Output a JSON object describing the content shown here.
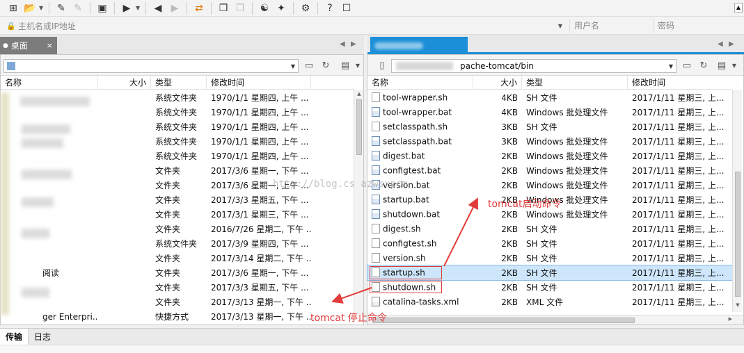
{
  "connection": {
    "host_placeholder": "主机名或IP地址",
    "user_placeholder": "用户名",
    "pass_placeholder": "密码"
  },
  "left_pane": {
    "tab_label": "桌面",
    "tab_close": "×",
    "columns": {
      "name": "名称",
      "size": "大小",
      "type": "类型",
      "mtime": "修改时间"
    },
    "rows": [
      {
        "name": "",
        "size": "",
        "type": "系统文件夹",
        "mtime": "1970/1/1 星期四, 上午 ..."
      },
      {
        "name": "",
        "size": "",
        "type": "系统文件夹",
        "mtime": "1970/1/1 星期四, 上午 ..."
      },
      {
        "name": "",
        "size": "",
        "type": "系统文件夹",
        "mtime": "1970/1/1 星期四, 上午 ..."
      },
      {
        "name": "",
        "size": "",
        "type": "系统文件夹",
        "mtime": "1970/1/1 星期四, 上午 ..."
      },
      {
        "name": "",
        "size": "",
        "type": "系统文件夹",
        "mtime": "1970/1/1 星期四, 上午 ..."
      },
      {
        "name": "",
        "size": "",
        "type": "文件夹",
        "mtime": "2017/3/6 星期一, 下午 ..."
      },
      {
        "name": "",
        "size": "",
        "type": "文件夹",
        "mtime": "2017/3/6 星期一, 上午 ..."
      },
      {
        "name": "",
        "size": "",
        "type": "文件夹",
        "mtime": "2017/3/3 星期五, 下午 ..."
      },
      {
        "name": "",
        "size": "",
        "type": "文件夹",
        "mtime": "2017/3/1 星期三, 下午 ..."
      },
      {
        "name": "",
        "size": "",
        "type": "文件夹",
        "mtime": "2016/7/26 星期二, 下午 ..."
      },
      {
        "name": "",
        "size": "",
        "type": "系统文件夹",
        "mtime": "2017/3/9 星期四, 下午 ..."
      },
      {
        "name": "",
        "size": "",
        "type": "文件夹",
        "mtime": "2017/3/14 星期二, 下午 ..."
      },
      {
        "name": "阅读",
        "size": "",
        "type": "文件夹",
        "mtime": "2017/3/6 星期一, 下午 ..."
      },
      {
        "name": "",
        "size": "",
        "type": "文件夹",
        "mtime": "2017/3/3 星期五, 下午 ..."
      },
      {
        "name": "",
        "size": "",
        "type": "文件夹",
        "mtime": "2017/3/13 星期一, 下午 ..."
      },
      {
        "name": "ger Enterpri...",
        "size": "",
        "type": "快捷方式",
        "mtime": "2017/3/13 星期一, 下午 ..."
      }
    ]
  },
  "right_pane": {
    "path": "pache-tomcat/bin",
    "columns": {
      "name": "名称",
      "size": "大小",
      "type": "类型",
      "mtime": "修改时间"
    },
    "rows": [
      {
        "name": "tool-wrapper.sh",
        "kind": "sh",
        "size": "4KB",
        "type": "SH 文件",
        "mtime": "2017/1/11 星期三, 上..."
      },
      {
        "name": "tool-wrapper.bat",
        "kind": "bat",
        "size": "4KB",
        "type": "Windows 批处理文件",
        "mtime": "2017/1/11 星期三, 上..."
      },
      {
        "name": "setclasspath.sh",
        "kind": "sh",
        "size": "3KB",
        "type": "SH 文件",
        "mtime": "2017/1/11 星期三, 上..."
      },
      {
        "name": "setclasspath.bat",
        "kind": "bat",
        "size": "3KB",
        "type": "Windows 批处理文件",
        "mtime": "2017/1/11 星期三, 上..."
      },
      {
        "name": "digest.bat",
        "kind": "bat",
        "size": "2KB",
        "type": "Windows 批处理文件",
        "mtime": "2017/1/11 星期三, 上..."
      },
      {
        "name": "configtest.bat",
        "kind": "bat",
        "size": "2KB",
        "type": "Windows 批处理文件",
        "mtime": "2017/1/11 星期三, 上..."
      },
      {
        "name": "version.bat",
        "kind": "bat",
        "size": "2KB",
        "type": "Windows 批处理文件",
        "mtime": "2017/1/11 星期三, 上..."
      },
      {
        "name": "startup.bat",
        "kind": "bat",
        "size": "2KB",
        "type": "Windows 批处理文件",
        "mtime": "2017/1/11 星期三, 上..."
      },
      {
        "name": "shutdown.bat",
        "kind": "bat",
        "size": "2KB",
        "type": "Windows 批处理文件",
        "mtime": "2017/1/11 星期三, 上..."
      },
      {
        "name": "digest.sh",
        "kind": "sh",
        "size": "2KB",
        "type": "SH 文件",
        "mtime": "2017/1/11 星期三, 上..."
      },
      {
        "name": "configtest.sh",
        "kind": "sh",
        "size": "2KB",
        "type": "SH 文件",
        "mtime": "2017/1/11 星期三, 上..."
      },
      {
        "name": "version.sh",
        "kind": "sh",
        "size": "2KB",
        "type": "SH 文件",
        "mtime": "2017/1/11 星期三, 上..."
      },
      {
        "name": "startup.sh",
        "kind": "sh",
        "size": "2KB",
        "type": "SH 文件",
        "mtime": "2017/1/11 星期三, 上...",
        "selected": true
      },
      {
        "name": "shutdown.sh",
        "kind": "sh",
        "size": "2KB",
        "type": "SH 文件",
        "mtime": "2017/1/11 星期三, 上..."
      },
      {
        "name": "catalina-tasks.xml",
        "kind": "xml",
        "size": "2KB",
        "type": "XML 文件",
        "mtime": "2017/1/11 星期三, 上..."
      }
    ]
  },
  "annotations": {
    "start_label": "tomcat启动命令",
    "stop_label": "tomcat 停止命令",
    "watermark": "http://blog.cs          azwsxpcm"
  },
  "bottom": {
    "tab_transfer": "传输",
    "tab_log": "日志"
  },
  "colors": {
    "accent": "#1b8fd8",
    "annotation": "#e23b3b",
    "selection": "#cde6fb"
  }
}
